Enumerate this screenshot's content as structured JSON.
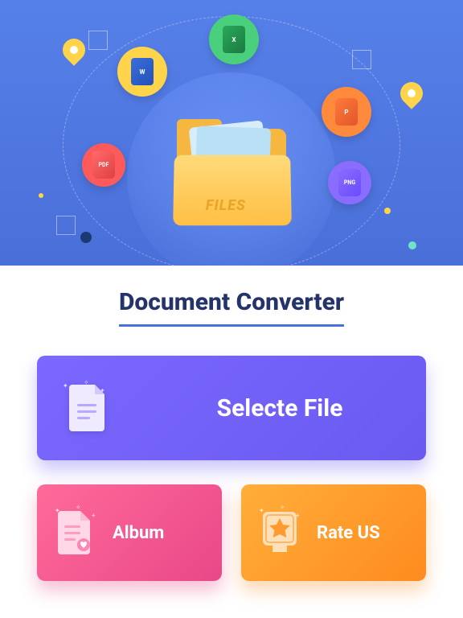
{
  "hero": {
    "folder_label": "FILES",
    "chips": {
      "excel": "X",
      "word": "W",
      "ppt": "P",
      "pdf": "PDF",
      "png": "PNG"
    }
  },
  "title": "Document Converter",
  "primary_button": {
    "label": "Selecte File"
  },
  "secondary_buttons": {
    "album": "Album",
    "rate": "Rate US"
  },
  "colors": {
    "primary": "#6a5af0",
    "pink": "#e94888",
    "orange": "#ff8b1f",
    "title": "#24336a"
  }
}
